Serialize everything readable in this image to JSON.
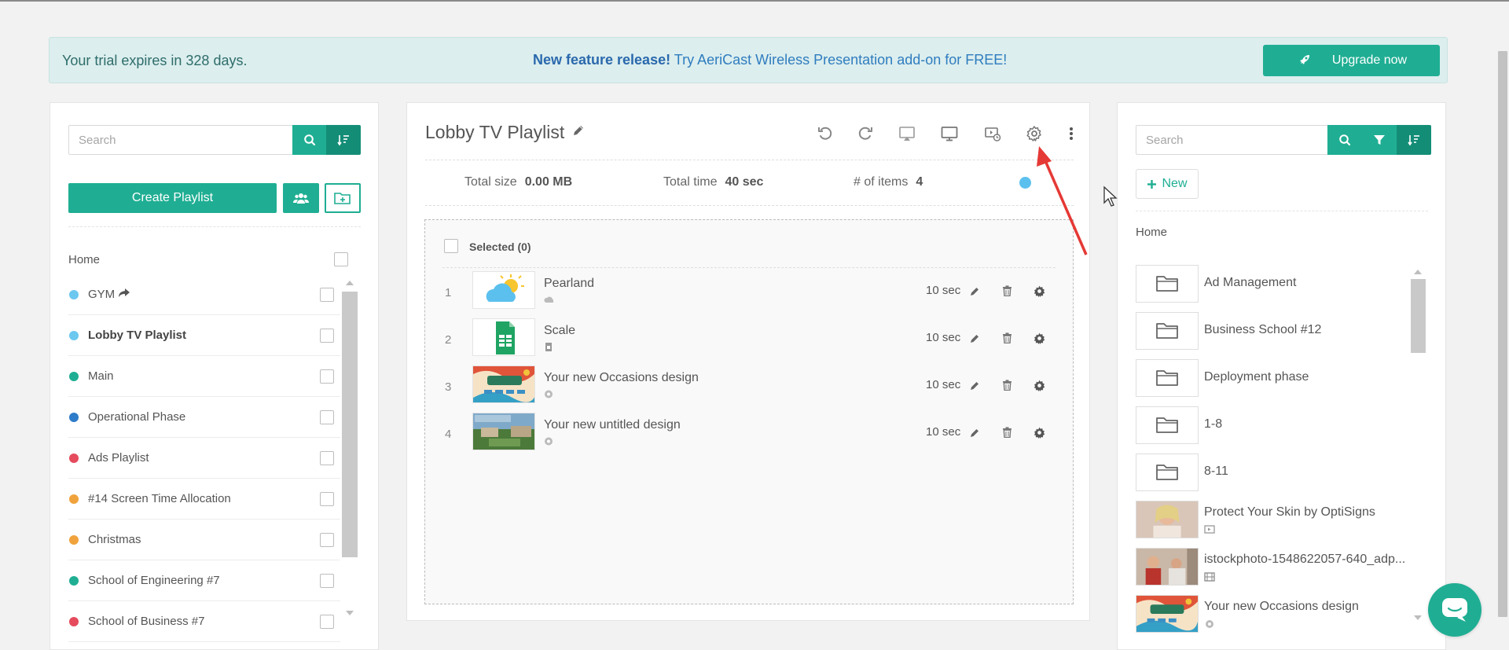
{
  "banner": {
    "trial_text": "Your trial expires in 328 days.",
    "feature_bold": "New feature release!",
    "feature_text": " Try AeriCast Wireless Presentation add-on for FREE!",
    "upgrade_label": "Upgrade now"
  },
  "left_panel": {
    "search_placeholder": "Search",
    "create_label": "Create Playlist",
    "home_label": "Home",
    "playlists": [
      {
        "name": "GYM",
        "color": "#6cc8ef",
        "shared": true,
        "active": false
      },
      {
        "name": "Lobby TV Playlist",
        "color": "#6cc8ef",
        "shared": false,
        "active": true
      },
      {
        "name": "Main",
        "color": "#1fae93",
        "shared": false,
        "active": false
      },
      {
        "name": "Operational Phase",
        "color": "#2e7bc9",
        "shared": false,
        "active": false
      },
      {
        "name": "Ads Playlist",
        "color": "#e54b5c",
        "shared": false,
        "active": false
      },
      {
        "name": "#14 Screen Time Allocation",
        "color": "#f0a33c",
        "shared": false,
        "active": false
      },
      {
        "name": "Christmas",
        "color": "#f0a33c",
        "shared": false,
        "active": false
      },
      {
        "name": "School of Engineering #7",
        "color": "#1fae93",
        "shared": false,
        "active": false
      },
      {
        "name": "School of Business #7",
        "color": "#e54b5c",
        "shared": false,
        "active": false
      }
    ]
  },
  "editor": {
    "title": "Lobby TV Playlist",
    "stats": {
      "size_label": "Total size",
      "size_value": "0.00 MB",
      "time_label": "Total time",
      "time_value": "40 sec",
      "items_label": "# of items",
      "items_value": "4"
    },
    "selected_label": "Selected (0)",
    "items": [
      {
        "num": "1",
        "name": "Pearland",
        "duration": "10 sec",
        "thumb": "weather"
      },
      {
        "num": "2",
        "name": "Scale",
        "duration": "10 sec",
        "thumb": "sheets"
      },
      {
        "num": "3",
        "name": "Your new Occasions design",
        "duration": "10 sec",
        "thumb": "occasions"
      },
      {
        "num": "4",
        "name": "Your new untitled design",
        "duration": "10 sec",
        "thumb": "campus"
      }
    ]
  },
  "right_panel": {
    "search_placeholder": "Search",
    "new_label": "New",
    "home_label": "Home",
    "items": [
      {
        "name": "Ad Management",
        "type": "folder"
      },
      {
        "name": "Business School #12",
        "type": "folder"
      },
      {
        "name": "Deployment phase",
        "type": "folder"
      },
      {
        "name": "1-8",
        "type": "folder"
      },
      {
        "name": "8-11",
        "type": "folder"
      },
      {
        "name": "Protect Your Skin by OptiSigns",
        "type": "video-app"
      },
      {
        "name": "istockphoto-1548622057-640_adp...",
        "type": "video"
      },
      {
        "name": "Your new Occasions design",
        "type": "design"
      }
    ]
  },
  "colors": {
    "accent": "#1fae93",
    "accent_dark": "#148d77",
    "annotation_arrow": "#e53935"
  }
}
